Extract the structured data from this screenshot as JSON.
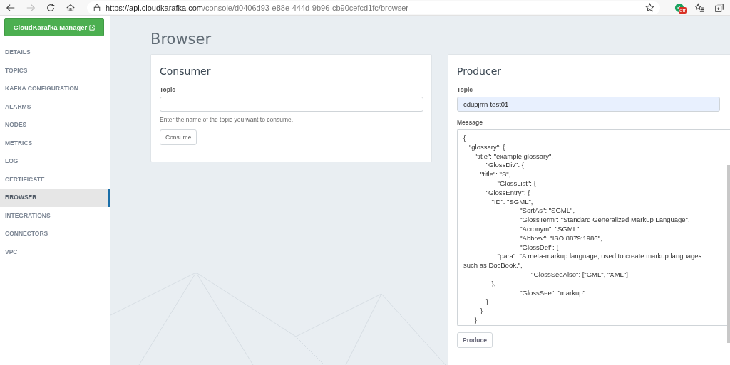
{
  "browser": {
    "url_host": "https://api.cloudkarafka.com",
    "url_path": "/console/d0406d93-e88e-444d-9b96-cb90cefcd1fc/browser",
    "forward_disabled": true,
    "extension_badge": "off"
  },
  "sidebar": {
    "manager_button": "CloudKarafka Manager",
    "items": [
      {
        "label": "DETAILS",
        "selected": false
      },
      {
        "label": "TOPICS",
        "selected": false
      },
      {
        "label": "KAFKA CONFIGURATION",
        "selected": false
      },
      {
        "label": "ALARMS",
        "selected": false
      },
      {
        "label": "NODES",
        "selected": false
      },
      {
        "label": "METRICS",
        "selected": false
      },
      {
        "label": "LOG",
        "selected": false
      },
      {
        "label": "CERTIFICATE",
        "selected": false
      },
      {
        "label": "BROWSER",
        "selected": true
      },
      {
        "label": "INTEGRATIONS",
        "selected": false
      },
      {
        "label": "CONNECTORS",
        "selected": false
      },
      {
        "label": "VPC",
        "selected": false
      }
    ]
  },
  "page_title": "Browser",
  "consumer": {
    "title": "Consumer",
    "topic_label": "Topic",
    "help": "Enter the name of the topic you want to consume.",
    "button": "Consume"
  },
  "producer": {
    "title": "Producer",
    "topic_label": "Topic",
    "topic_value": "cdupjrrn-test01",
    "topic_autofilled": true,
    "message_label": "Message",
    "message_lines": [
      "{",
      "   \"glossary\": {",
      "      \"title\": \"example glossary\",",
      "            \"GlossDiv\": {",
      "         \"title\": \"S\",",
      "                  \"GlossList\": {",
      "            \"GlossEntry\": {",
      "               \"ID\": \"SGML\",",
      "                              \"SortAs\": \"SGML\",",
      "                              \"GlossTerm\": \"Standard Generalized Markup Language\",",
      "                              \"Acronym\": \"SGML\",",
      "                              \"Abbrev\": \"ISO 8879:1986\",",
      "                              \"GlossDef\": {",
      "                  \"para\": \"A meta-markup language, used to create markup languages such as DocBook.\",",
      "                                    \"GlossSeeAlso\": [\"GML\", \"XML\"]",
      "               },",
      "                              \"GlossSee\": \"markup\"",
      "            }",
      "         }",
      "      }"
    ],
    "button": "Produce"
  }
}
